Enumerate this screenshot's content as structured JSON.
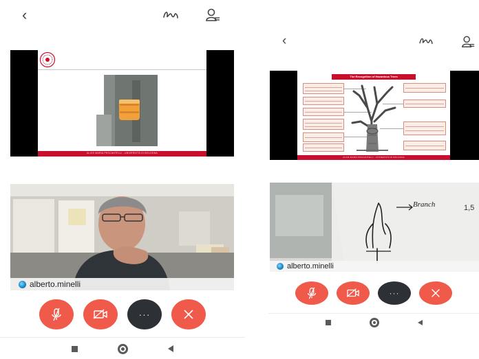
{
  "screens": [
    {
      "participant": {
        "name": "alberto.minelli"
      },
      "slide": {
        "footer_text": "ALICE MARIA PESCANTELLI - UNIVERSITÀ DI BOLOGNA"
      },
      "icons": {
        "back": "chevron-left-icon",
        "annotate": "squiggle-annotation-icon",
        "participants": "participants-list-icon"
      },
      "controls": {
        "more_label": "···"
      }
    },
    {
      "participant": {
        "name": "alberto.minelli"
      },
      "slide": {
        "title": "The Recognition of Hazardous Trees",
        "footer_text": "ALICE MARIA PESCANTELLI - UNIVERSITÀ DI BOLOGNA"
      },
      "whiteboard": {
        "label": "Branch"
      },
      "icons": {
        "back": "chevron-left-icon",
        "annotate": "squiggle-annotation-icon",
        "participants": "participants-list-icon"
      },
      "controls": {
        "more_label": "···"
      }
    }
  ],
  "colors": {
    "accent_red": "#f05a4a",
    "dark_button": "#2d3136",
    "slide_red": "#c8102e"
  }
}
